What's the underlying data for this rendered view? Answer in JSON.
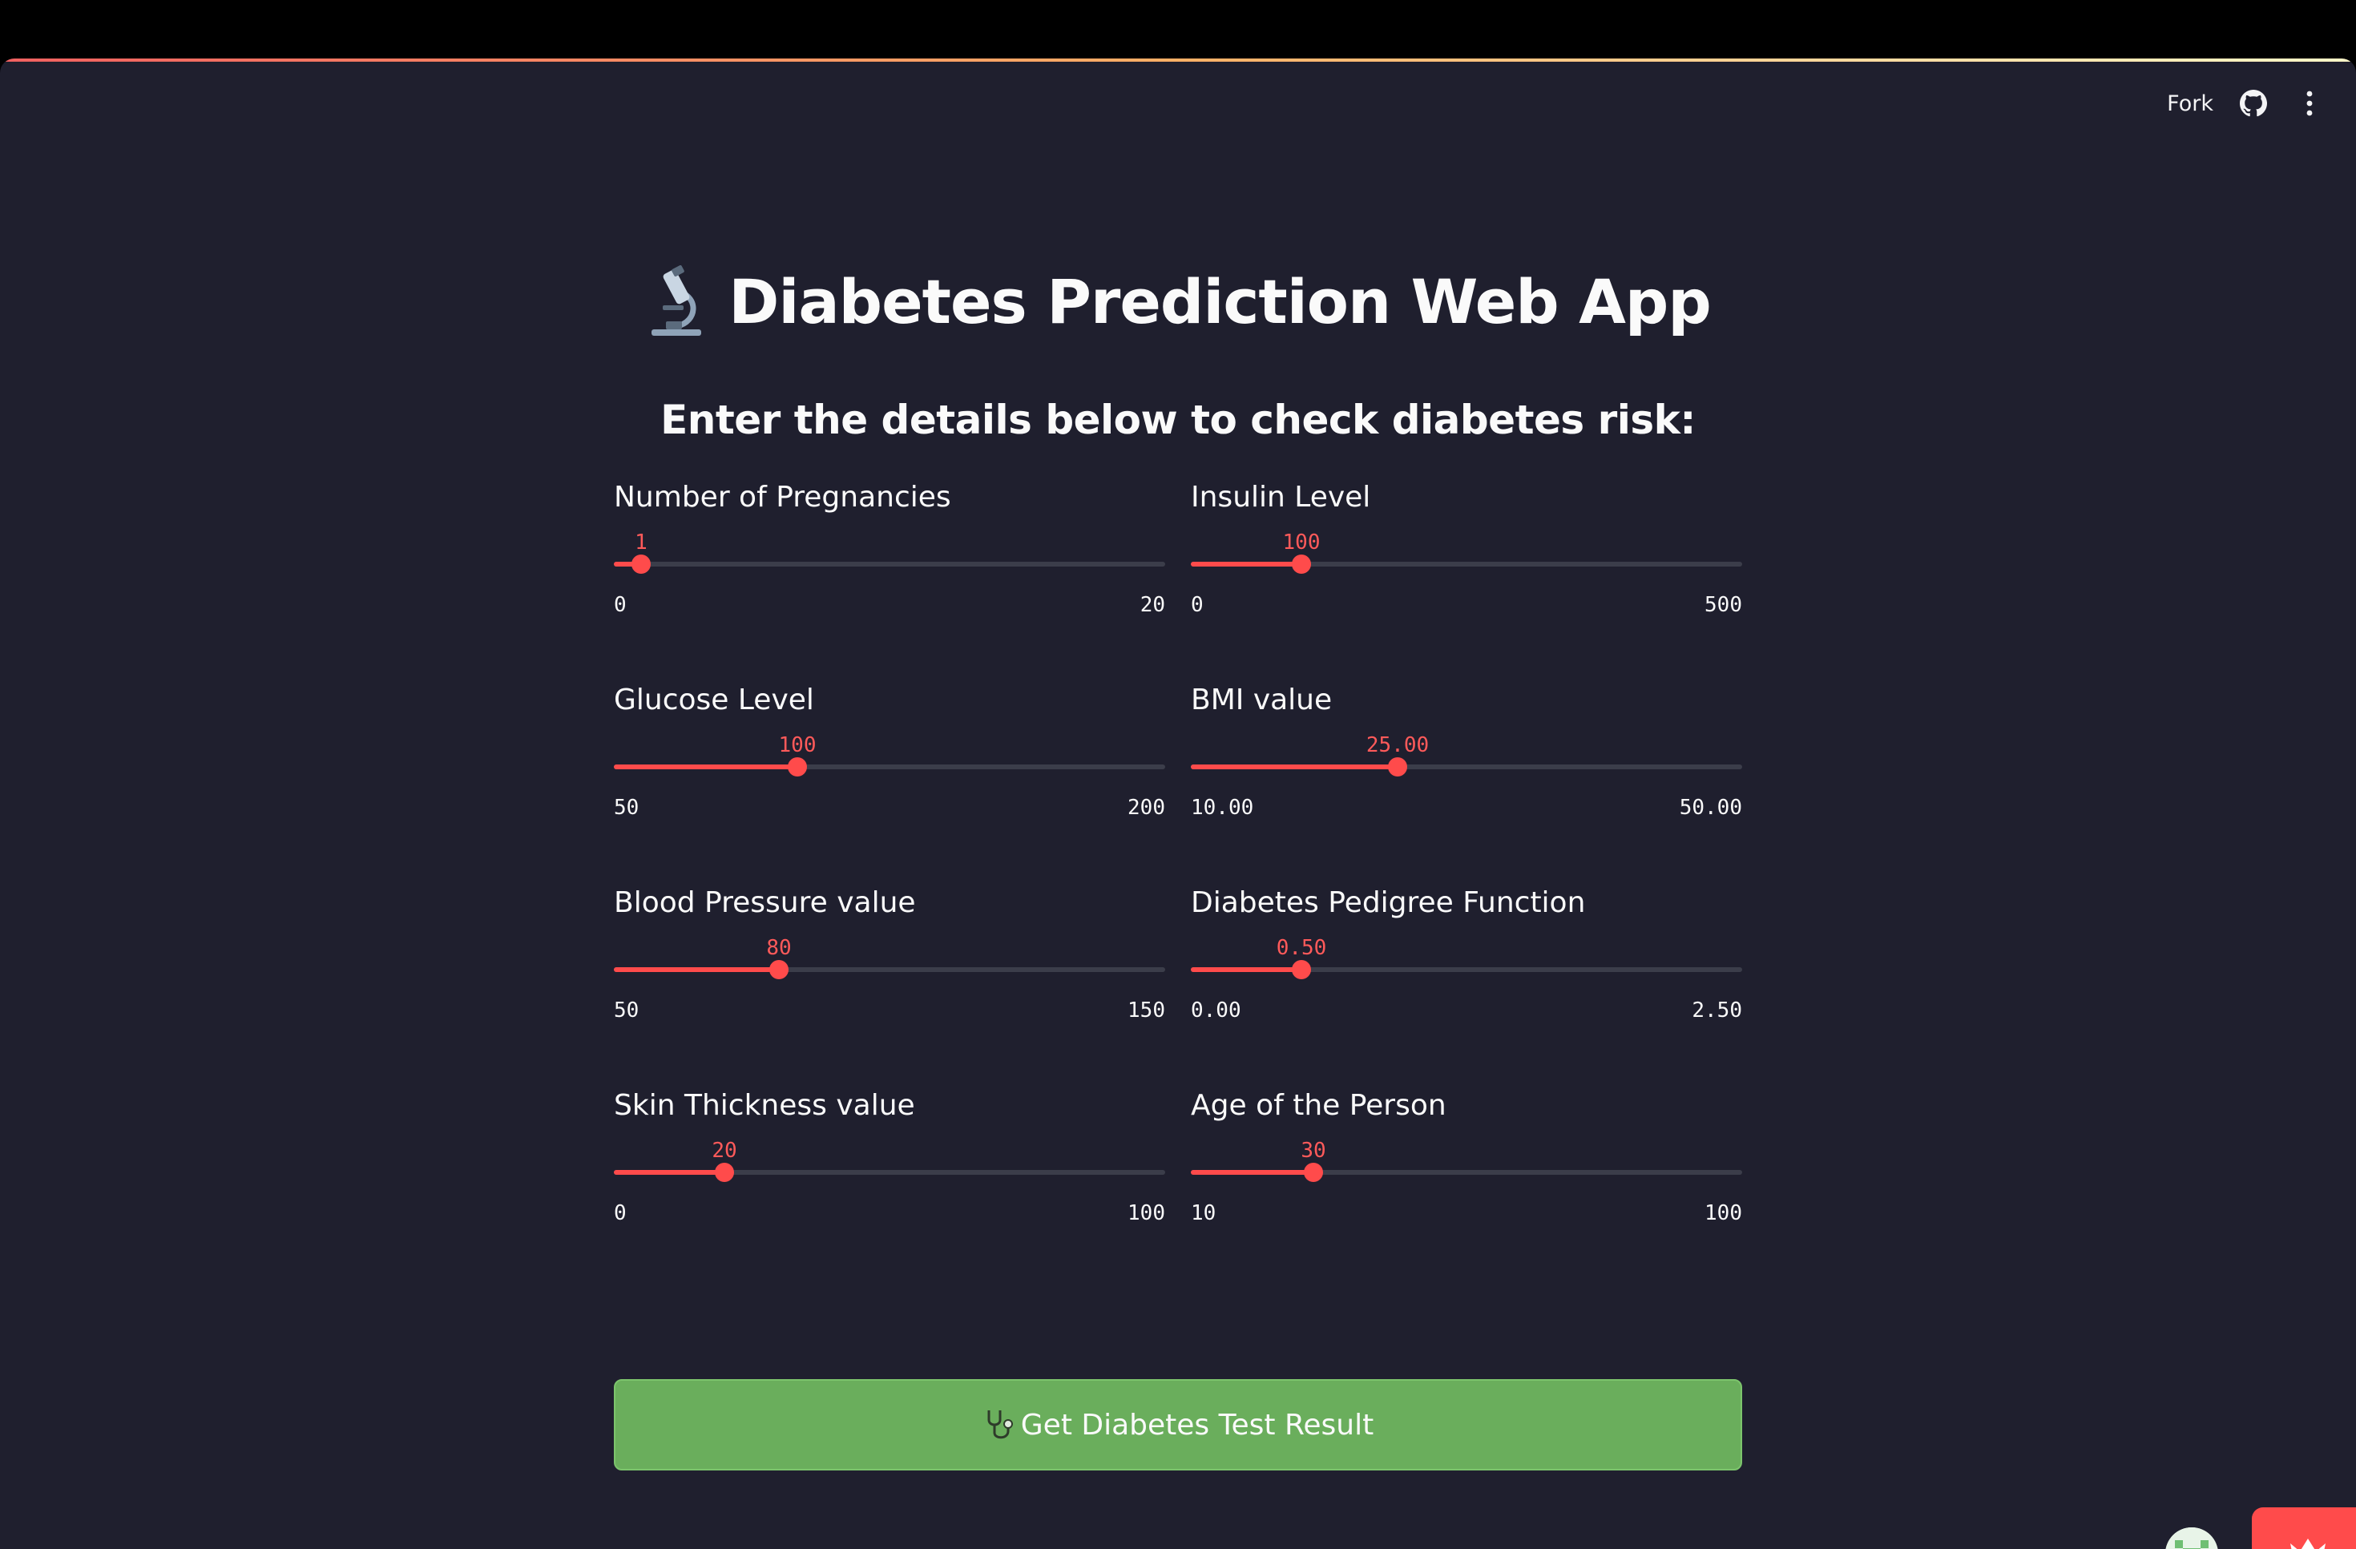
{
  "app": {
    "title": "Diabetes Prediction Web App",
    "subtitle": "Enter the details below to check diabetes risk:"
  },
  "toolbar": {
    "fork_label": "Fork",
    "github_icon": "github-icon",
    "menu_icon": "kebab-menu-icon"
  },
  "colors": {
    "background": "#1f1f2e",
    "accent": "#ff4b4b",
    "track": "#3b3d4a",
    "button": "#6aae5c",
    "text": "#fafafa"
  },
  "sliders": [
    {
      "label": "Number of Pregnancies",
      "value": "1",
      "min": "0",
      "max": "20",
      "fraction": 0.05
    },
    {
      "label": "Insulin Level",
      "value": "100",
      "min": "0",
      "max": "500",
      "fraction": 0.2
    },
    {
      "label": "Glucose Level",
      "value": "100",
      "min": "50",
      "max": "200",
      "fraction": 0.3333
    },
    {
      "label": "BMI value",
      "value": "25.00",
      "min": "10.00",
      "max": "50.00",
      "fraction": 0.375
    },
    {
      "label": "Blood Pressure value",
      "value": "80",
      "min": "50",
      "max": "150",
      "fraction": 0.3
    },
    {
      "label": "Diabetes Pedigree Function",
      "value": "0.50",
      "min": "0.00",
      "max": "2.50",
      "fraction": 0.2
    },
    {
      "label": "Skin Thickness value",
      "value": "20",
      "min": "0",
      "max": "100",
      "fraction": 0.2
    },
    {
      "label": "Age of the Person",
      "value": "30",
      "min": "10",
      "max": "100",
      "fraction": 0.2222
    }
  ],
  "submit": {
    "label": "Get Diabetes Test Result",
    "icon": "stethoscope-icon"
  }
}
